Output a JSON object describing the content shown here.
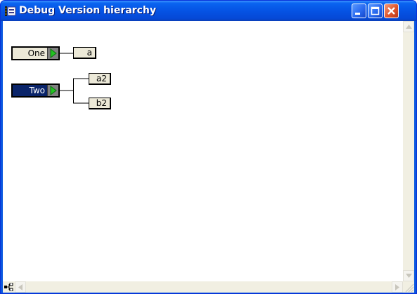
{
  "window": {
    "title": "Debug Version hierarchy",
    "icon": "app-icon",
    "controls": [
      "minimize-icon",
      "maximize-icon",
      "close-icon"
    ]
  },
  "hierarchy": {
    "nodes": [
      {
        "label": "One",
        "selected": false,
        "children": [
          "a"
        ]
      },
      {
        "label": "Two",
        "selected": true,
        "children": [
          "a2",
          "b2"
        ]
      }
    ]
  },
  "statusbar": {
    "icon": "hierarchy-icon"
  },
  "colors": {
    "titlebar": "#0553e4",
    "node_fill": "#ece9d8",
    "selected_fill": "#0a246a",
    "arrow_green": "#22c322",
    "close_red": "#e0552c"
  }
}
